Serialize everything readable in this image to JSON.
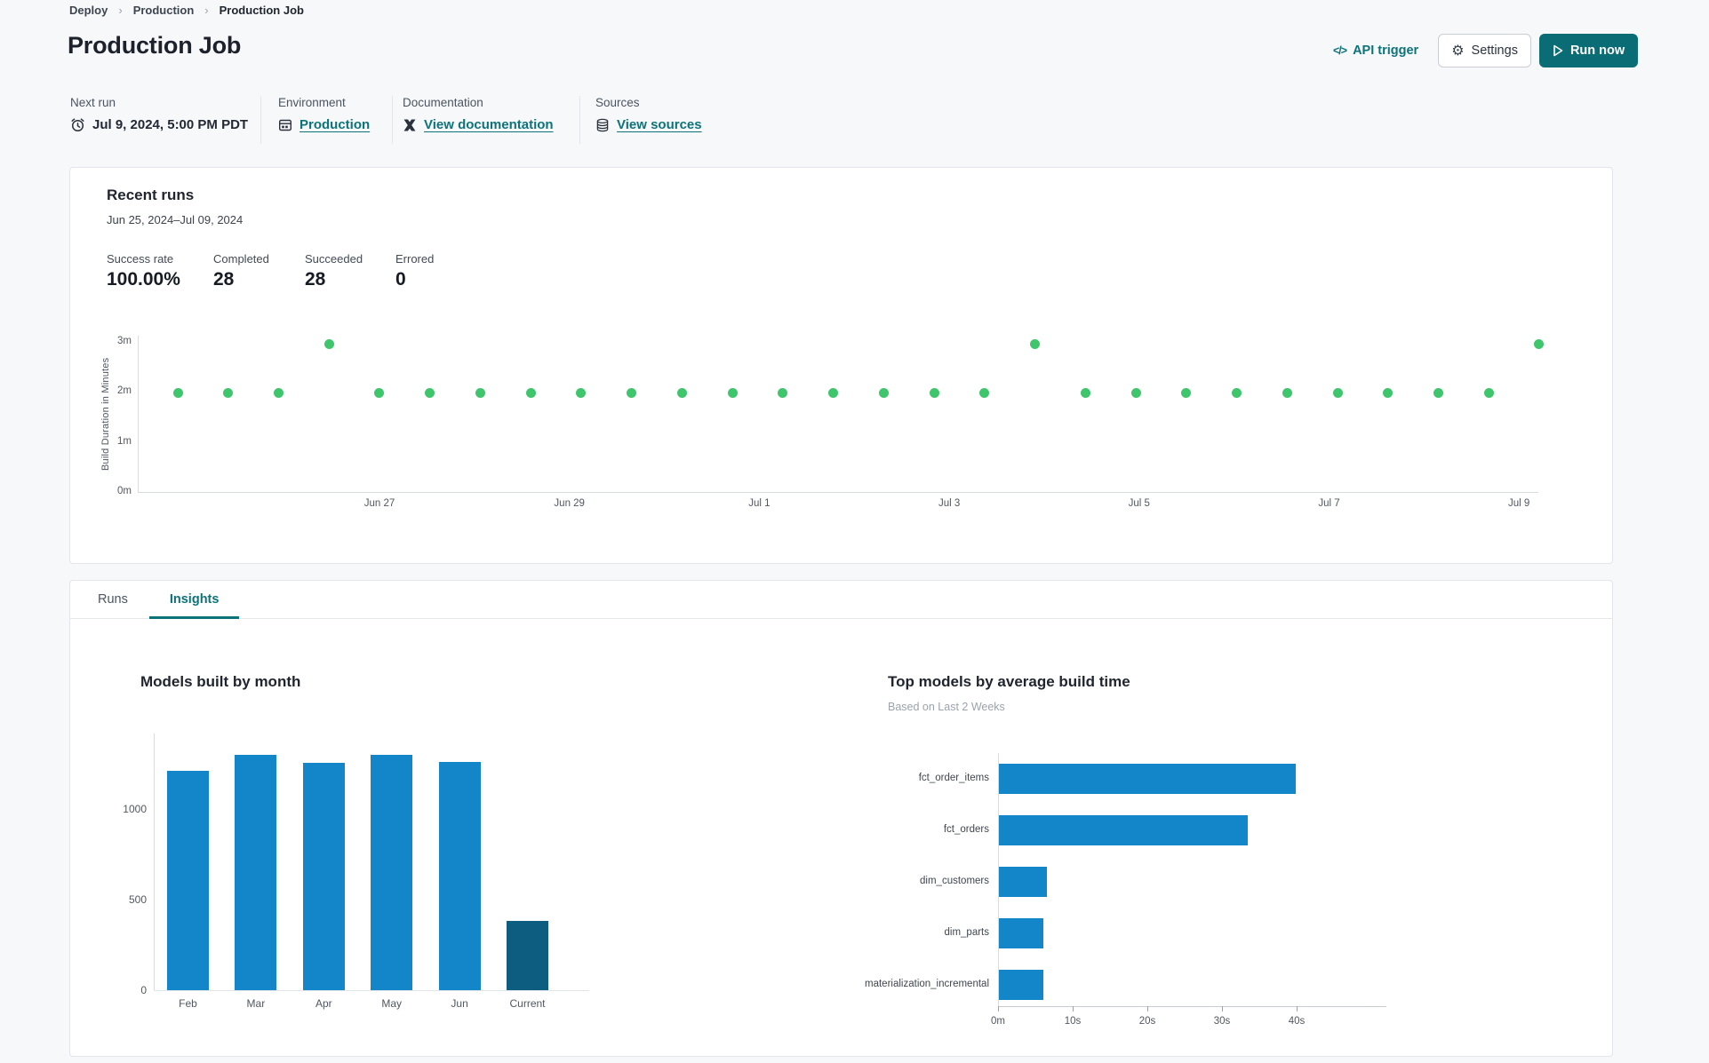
{
  "breadcrumb": {
    "items": [
      "Deploy",
      "Production",
      "Production Job"
    ]
  },
  "header": {
    "title": "Production Job",
    "api_trigger_label": "API trigger",
    "api_trigger_icon": "</>",
    "settings_label": "Settings",
    "run_now_label": "Run now"
  },
  "meta": {
    "columns": [
      {
        "label": "Next run",
        "value": "Jul 9, 2024, 5:00 PM PDT",
        "icon": "alarm-clock-icon"
      },
      {
        "label": "Environment",
        "value": "Production",
        "icon": "environment-icon"
      },
      {
        "label": "Documentation",
        "value": "View documentation",
        "icon": "dbt-docs-icon"
      },
      {
        "label": "Sources",
        "value": "View sources",
        "icon": "database-icon"
      }
    ]
  },
  "recent_runs": {
    "title": "Recent runs",
    "date_range": "Jun 25, 2024–Jul 09, 2024",
    "stats": [
      {
        "label": "Success rate",
        "value": "100.00%"
      },
      {
        "label": "Completed",
        "value": "28"
      },
      {
        "label": "Succeeded",
        "value": "28"
      },
      {
        "label": "Errored",
        "value": "0"
      }
    ]
  },
  "tabs": [
    {
      "label": "Runs",
      "active": false
    },
    {
      "label": "Insights",
      "active": true
    }
  ],
  "insights": {
    "models_by_month_title": "Models built by month",
    "top_models_title": "Top models by average build time",
    "top_models_subtitle": "Based on Last 2 Weeks"
  },
  "colors": {
    "accent_teal": "#0a6c74",
    "link_teal": "#0d737b",
    "bar_blue": "#1286c8",
    "bar_current_dark": "#0c5d7f",
    "dot_green": "#3fc56c"
  },
  "chart_data": [
    {
      "type": "scatter",
      "title": "Recent runs build duration",
      "ylabel": "Build Duration in Minutes",
      "y_ticks": [
        "0m",
        "1m",
        "2m",
        "3m"
      ],
      "ylim_minutes": [
        0,
        3.1
      ],
      "x_ticks": [
        "Jun 27",
        "Jun 29",
        "Jul 1",
        "Jul 3",
        "Jul 5",
        "Jul 7",
        "Jul 9"
      ],
      "point_color": "#3fc56c",
      "points_minutes": [
        1.97,
        1.97,
        1.97,
        2.95,
        1.97,
        1.97,
        1.97,
        1.97,
        1.97,
        1.97,
        1.97,
        1.97,
        1.97,
        1.97,
        1.97,
        1.97,
        1.97,
        2.95,
        1.97,
        1.97,
        1.97,
        1.97,
        1.97,
        1.97,
        1.97,
        1.97,
        1.97,
        2.95
      ]
    },
    {
      "type": "bar",
      "title": "Models built by month",
      "categories": [
        "Feb",
        "Mar",
        "Apr",
        "May",
        "Jun",
        "Current"
      ],
      "values": [
        1210,
        1295,
        1250,
        1295,
        1255,
        380
      ],
      "y_ticks": [
        0,
        500,
        1000
      ],
      "ylim": [
        0,
        1420
      ],
      "bar_color": "#1286c8",
      "current_bar_color": "#0c5d7f"
    },
    {
      "type": "bar-horizontal",
      "title": "Top models by average build time",
      "subtitle": "Based on Last 2 Weeks",
      "categories": [
        "fct_order_items",
        "fct_orders",
        "dim_customers",
        "dim_parts",
        "materialization_incremental"
      ],
      "values_seconds": [
        39.8,
        33.3,
        6.4,
        6.0,
        5.9
      ],
      "x_ticks": [
        "0m",
        "10s",
        "20s",
        "30s",
        "40s"
      ],
      "xlim_seconds": [
        0,
        44
      ],
      "bar_color": "#1286c8"
    }
  ]
}
